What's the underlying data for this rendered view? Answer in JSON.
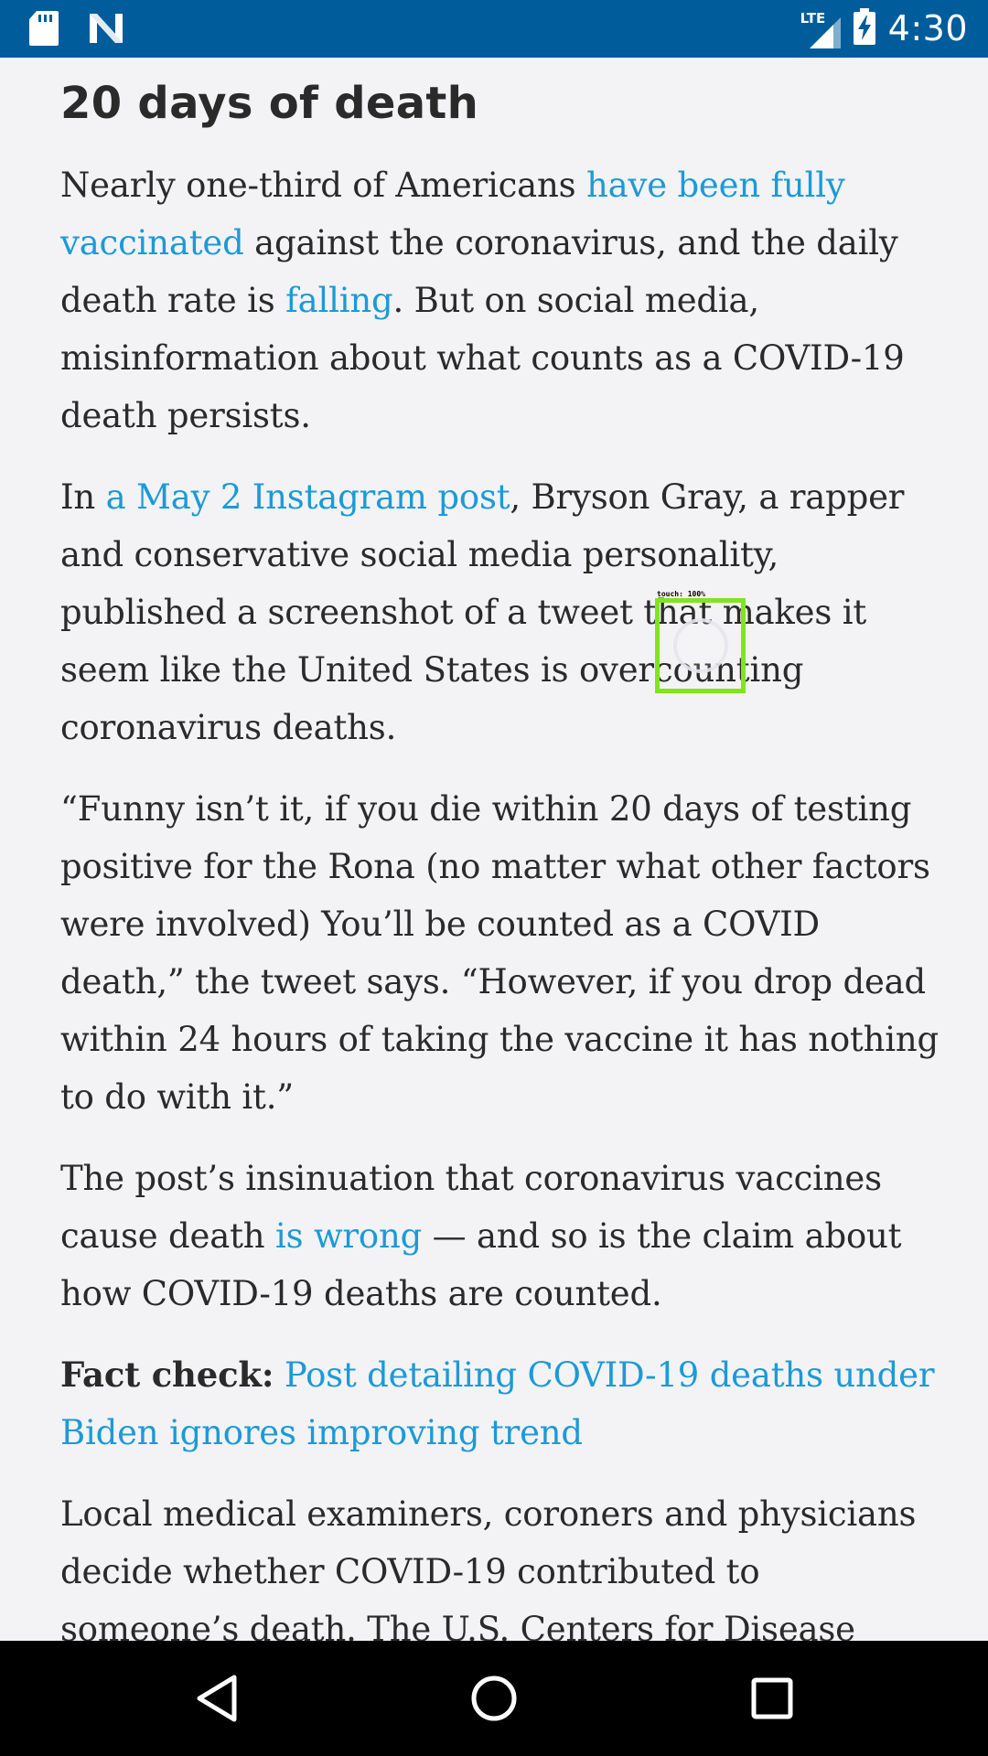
{
  "status_bar": {
    "time": "4:30",
    "network": "LTE",
    "icons": [
      "sd-card-icon",
      "notification-n-icon",
      "signal-icon",
      "battery-charging-icon"
    ]
  },
  "article": {
    "heading": "20 days of death",
    "p1": {
      "t1": "Nearly one-third of Americans ",
      "link1": "have been fully vaccinated",
      "t2": " against the coronavirus, and the daily death rate is ",
      "link2": "falling",
      "t3": ". But on social media, misinformation about what counts as a COVID-19 death persists."
    },
    "p2": {
      "t1": "In ",
      "link1": "a May 2 Instagram post",
      "t2": ", Bryson Gray, a rapper and conservative social media personality, published a screenshot of a tweet that makes it seem like the United States is overcounting coronavirus deaths."
    },
    "p3": "“Funny isn’t it, if you die within 20 days of testing positive for the Rona (no matter what other factors were involved) You’ll be counted as a COVID death,” the tweet says. “However, if you drop dead within 24 hours of taking the vaccine it has nothing to do with it.”",
    "p4": {
      "t1": "The post’s insinuation that coronavirus vaccines cause death ",
      "link1": "is wrong",
      "t2": " — and so is the claim about how COVID-19 deaths are counted."
    },
    "p5": {
      "label": "Fact check:",
      "link1": "Post detailing COVID-19 deaths under Biden ignores improving trend"
    },
    "p6": "Local medical examiners, coroners and physicians decide whether COVID-19 contributed to someone’s death. The U.S. Centers for Disease"
  },
  "touch_overlay": {
    "label": "touch: 100%"
  },
  "colors": {
    "status_bar": "#015c9b",
    "link": "#1c9ad6",
    "text": "#2a2a2a",
    "background": "#f3f3f5",
    "touch_box": "#7ee51f"
  }
}
